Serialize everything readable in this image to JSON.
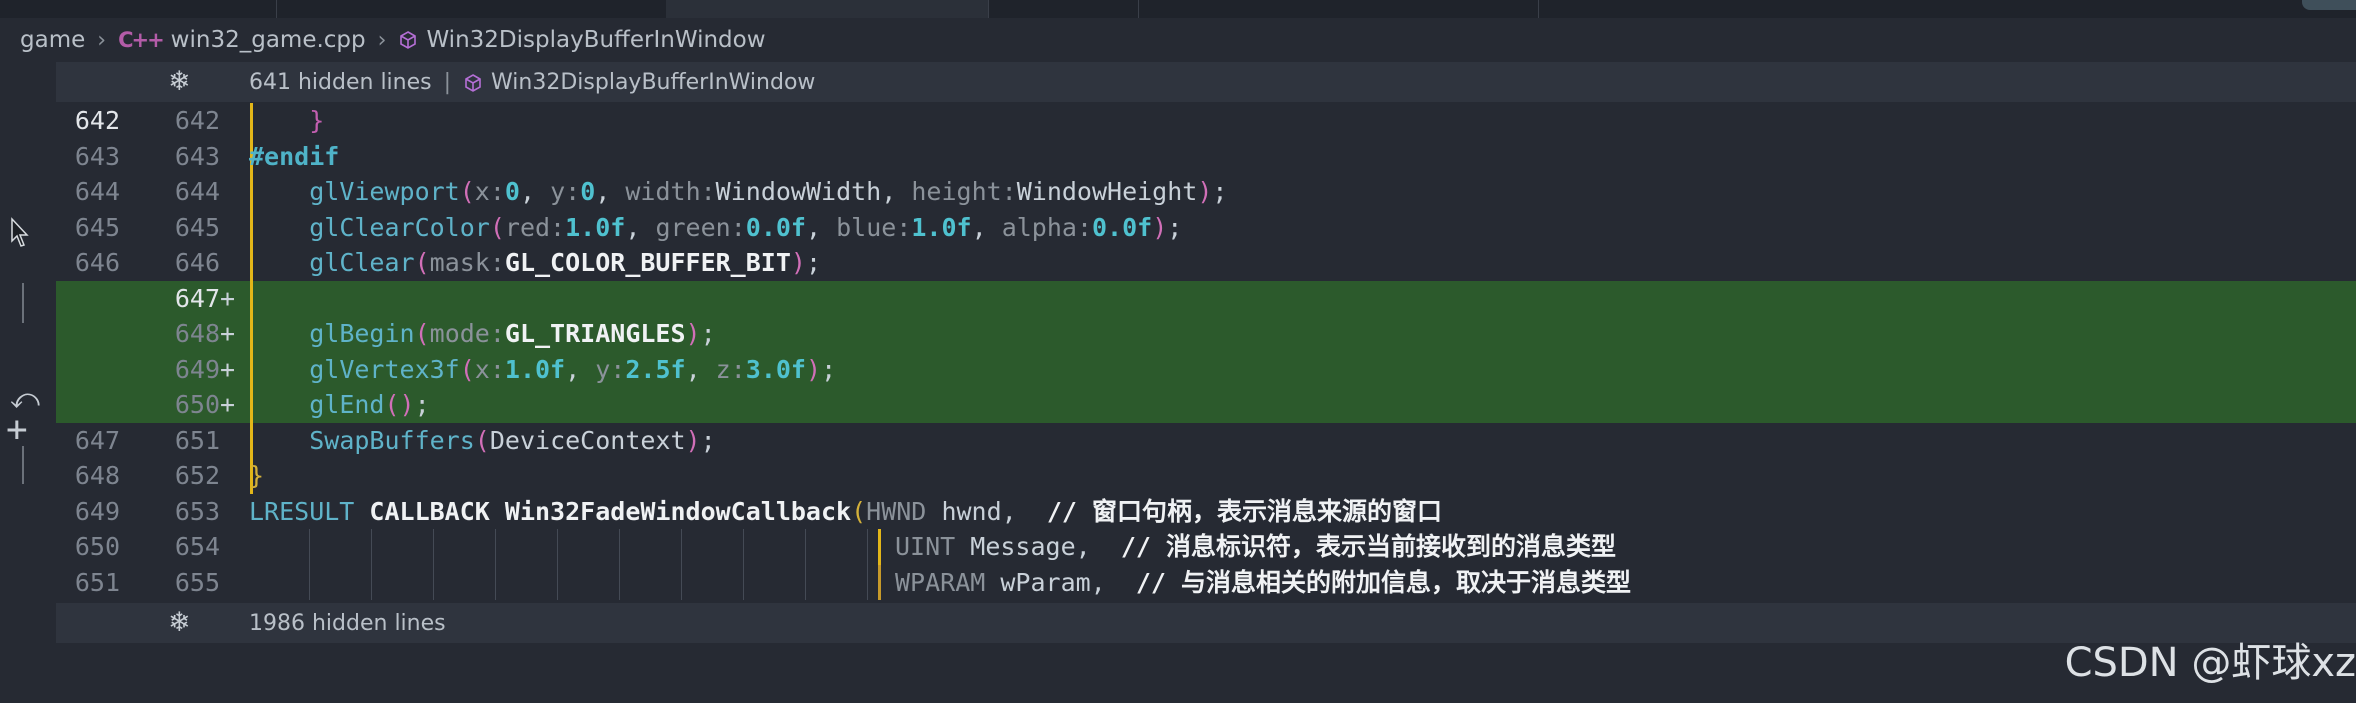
{
  "breadcrumb": {
    "folder": "game",
    "cpp_badge": "C++",
    "file": "win32_game.cpp",
    "symbol": "Win32DisplayBufferInWindow"
  },
  "fold_top": {
    "hidden": "641 hidden lines",
    "pipe": "|",
    "symbol": "Win32DisplayBufferInWindow"
  },
  "fold_bottom": {
    "hidden": "1986 hidden lines"
  },
  "lines": {
    "l642": {
      "old": "642",
      "new": "642"
    },
    "l643": {
      "old": "643",
      "new": "643"
    },
    "l644": {
      "old": "644",
      "new": "644"
    },
    "l645": {
      "old": "645",
      "new": "645"
    },
    "l646": {
      "old": "646",
      "new": "646"
    },
    "l647": {
      "new": "647",
      "plus": "+"
    },
    "l648": {
      "new": "648",
      "plus": "+"
    },
    "l649": {
      "new": "649",
      "plus": "+"
    },
    "l650": {
      "new": "650",
      "plus": "+"
    },
    "l651": {
      "old": "647",
      "new": "651"
    },
    "l652": {
      "old": "648",
      "new": "652"
    },
    "l653": {
      "old": "649",
      "new": "653"
    },
    "l654": {
      "old": "650",
      "new": "654"
    },
    "l655": {
      "old": "651",
      "new": "655"
    }
  },
  "code": {
    "closing_brace": "}",
    "endif": "#endif",
    "viewport": {
      "fn": "glViewport",
      "h1": "x:",
      "v1": "0",
      "h2": "y:",
      "v2": "0",
      "h3": "width:",
      "v3": "WindowWidth",
      "h4": "height:",
      "v4": "WindowHeight"
    },
    "clearcolor": {
      "fn": "glClearColor",
      "h1": "red:",
      "v1": "1.0f",
      "h2": "green:",
      "v2": "0.0f",
      "h3": "blue:",
      "v3": "1.0f",
      "h4": "alpha:",
      "v4": "0.0f"
    },
    "clear": {
      "fn": "glClear",
      "h1": "mask:",
      "v1": "GL_COLOR_BUFFER_BIT"
    },
    "begin": {
      "fn": "glBegin",
      "h1": "mode:",
      "v1": "GL_TRIANGLES"
    },
    "vertex": {
      "fn": "glVertex3f",
      "h1": "x:",
      "v1": "1.0f",
      "h2": "y:",
      "v2": "2.5f",
      "h3": "z:",
      "v3": "3.0f"
    },
    "end": {
      "fn": "glEnd"
    },
    "swap": {
      "fn": "SwapBuffers",
      "arg": "DeviceContext"
    },
    "func_close": "}",
    "callback": {
      "ret": "LRESULT",
      "cc": "CALLBACK",
      "name": "Win32FadeWindowCallback",
      "t1": "HWND",
      "p1": "hwnd,",
      "c1": "// 窗口句柄，表示消息来源的窗口"
    },
    "param2": {
      "t": "UINT",
      "p": "Message,",
      "c": "// 消息标识符，表示当前接收到的消息类型"
    },
    "param3": {
      "t": "WPARAM",
      "p": "wParam,",
      "c": "// 与消息相关的附加信息，取决于消息类型"
    }
  },
  "watermark": "CSDN @虾球xz",
  "colors": {
    "added_bg": "#2c5a2c",
    "modified_bar": "#e2b619",
    "function": "#5fb3c9",
    "number": "#4fc1cf"
  }
}
